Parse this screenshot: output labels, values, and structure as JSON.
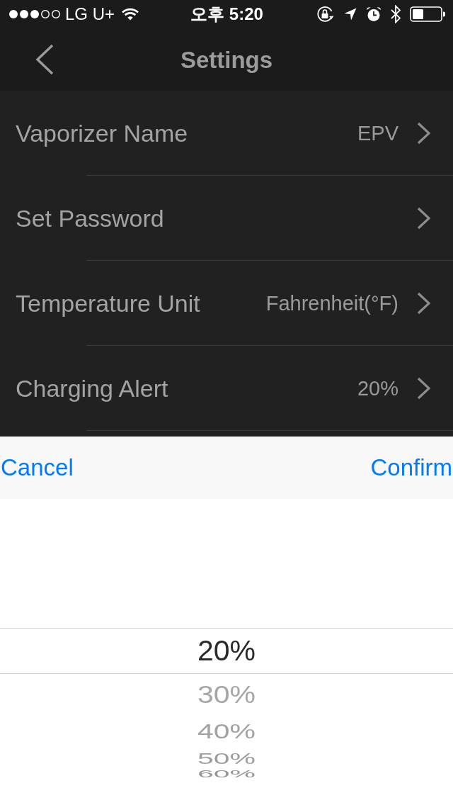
{
  "status_bar": {
    "carrier": "LG U+",
    "time": "오후 5:20"
  },
  "nav_bar": {
    "title": "Settings"
  },
  "settings": [
    {
      "label": "Vaporizer Name",
      "value": "EPV"
    },
    {
      "label": "Set Password"
    },
    {
      "label": "Temperature Unit",
      "value": "Fahrenheit(°F)"
    },
    {
      "label": "Charging Alert",
      "value": "20%"
    }
  ],
  "picker_toolbar": {
    "cancel": "Cancel",
    "confirm": "Confirm"
  },
  "picker": {
    "options": [
      {
        "label": "20%",
        "selected": true
      },
      {
        "label": "30%",
        "selected": false
      },
      {
        "label": "40%",
        "selected": false
      },
      {
        "label": "50%",
        "selected": false
      },
      {
        "label": "60%",
        "selected": false
      }
    ]
  }
}
